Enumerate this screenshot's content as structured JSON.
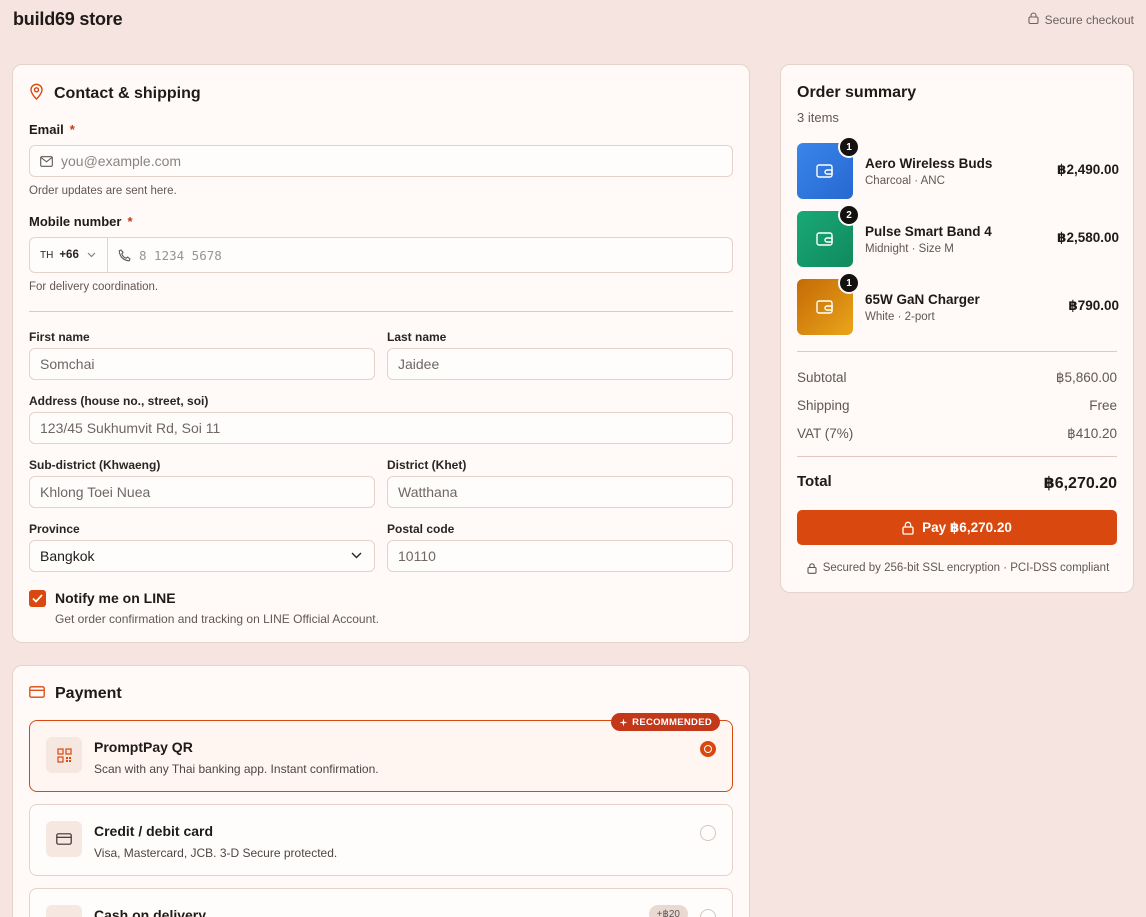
{
  "header": {
    "brand": "build69 store",
    "secure_label": "Secure checkout"
  },
  "contact": {
    "title": "Contact & shipping",
    "email": {
      "label": "Email",
      "required_mark": "*",
      "placeholder": "you@example.com",
      "hint": "Order updates are sent here."
    },
    "mobile": {
      "label": "Mobile number",
      "required_mark": "*",
      "country_code": "TH",
      "dial_code": "+66",
      "placeholder": "8 1234 5678",
      "hint": "For delivery coordination."
    },
    "first_name": {
      "label": "First name",
      "value": "Somchai"
    },
    "last_name": {
      "label": "Last name",
      "value": "Jaidee"
    },
    "address": {
      "label": "Address (house no., street, soi)",
      "value": "123/45 Sukhumvit Rd, Soi 11"
    },
    "subdistrict": {
      "label": "Sub-district (Khwaeng)",
      "value": "Khlong Toei Nuea"
    },
    "district": {
      "label": "District (Khet)",
      "value": "Watthana"
    },
    "province": {
      "label": "Province",
      "value": "Bangkok"
    },
    "postal": {
      "label": "Postal code",
      "value": "10110"
    },
    "line_notify": {
      "label": "Notify me on LINE",
      "description": "Get order confirmation and tracking on LINE Official Account.",
      "checked": true
    }
  },
  "payment": {
    "title": "Payment",
    "options": [
      {
        "name": "PromptPay QR",
        "description": "Scan with any Thai banking app. Instant confirmation.",
        "badge": "RECOMMENDED",
        "selected": true,
        "icon": "qr-code-icon"
      },
      {
        "name": "Credit / debit card",
        "description": "Visa, Mastercard, JCB. 3-D Secure protected.",
        "selected": false,
        "icon": "credit-card-icon"
      },
      {
        "name": "Cash on delivery",
        "fee": "+฿20",
        "selected": false,
        "icon": "cash-icon"
      }
    ]
  },
  "summary": {
    "title": "Order summary",
    "count": "3 items",
    "items": [
      {
        "qty": "1",
        "name": "Aero Wireless Buds",
        "variant": "Charcoal · ANC",
        "price": "฿2,490.00",
        "color": "#2f7ae0"
      },
      {
        "qty": "2",
        "name": "Pulse Smart Band 4",
        "variant": "Midnight · Size M",
        "price": "฿2,580.00",
        "color": "#169a6c"
      },
      {
        "qty": "1",
        "name": "65W GaN Charger",
        "variant": "White · 2-port",
        "price": "฿790.00",
        "color": "#d98a0b"
      }
    ],
    "subtotal_label": "Subtotal",
    "subtotal": "฿5,860.00",
    "shipping_label": "Shipping",
    "shipping": "Free",
    "vat_label": "VAT (7%)",
    "vat": "฿410.20",
    "total_label": "Total",
    "total": "฿6,270.20",
    "pay_button": "Pay ฿6,270.20",
    "ssl_note": "Secured by 256-bit SSL encryption · PCI-DSS compliant"
  },
  "colors": {
    "accent": "#d9480f",
    "background": "#f5e4df",
    "card": "#fffaf7"
  }
}
